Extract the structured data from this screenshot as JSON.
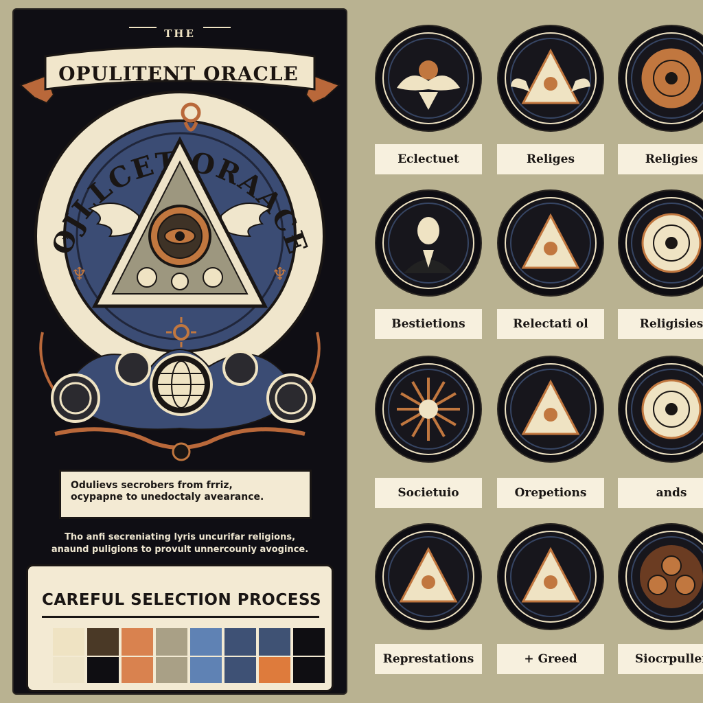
{
  "poster": {
    "the_label": "THE",
    "title": "OPULITENT ORACLE",
    "arc_text": "OJLLCET ORAACE",
    "tagline_lines": [
      "Odulievs secrobers from frriz,",
      "ocypapne to unedoctaly avearance."
    ],
    "subtitle_lines": [
      "Tho anfi secreniating lyris uncurifar religions,",
      "anaund puligions to provult unnercouniy avogince."
    ]
  },
  "selection": {
    "title": "CAREFUL SELECTION PROCESS",
    "swatch_rows": [
      [
        "#efe3c3",
        "#4a3926",
        "#d9824f",
        "#a9a086",
        "#5f82b4",
        "#3e5175",
        "#3f5274",
        "#0f0e12"
      ],
      [
        "#eee4c8",
        "#0f0e12",
        "#d9824f",
        "#a9a086",
        "#5f82b4",
        "#3e5175",
        "#de7b3c",
        "#0f0e12"
      ]
    ]
  },
  "grid": {
    "labels": [
      "Eclectuet",
      "Religes",
      "Religies",
      "Bestietions",
      "Relectati ol",
      "Religisies",
      "Societuio",
      "Orepetions",
      "ands",
      "Represtations",
      "+ Greed",
      "Siocrpuller"
    ],
    "badge_icons": [
      "winged-eye-icon",
      "winged-pyramid-icon",
      "compass-disc-icon",
      "suited-figure-icon",
      "pyramid-icon",
      "mandala-icon",
      "starburst-icon",
      "pyramid-icon",
      "eye-ring-icon",
      "pyramid-icon",
      "pyramid-icon",
      "orbs-icon"
    ]
  },
  "colors": {
    "background": "#b9b291",
    "poster": "#0f0e14",
    "cream": "#efe3c3",
    "copper": "#c1773f",
    "navy": "#3e5175"
  }
}
